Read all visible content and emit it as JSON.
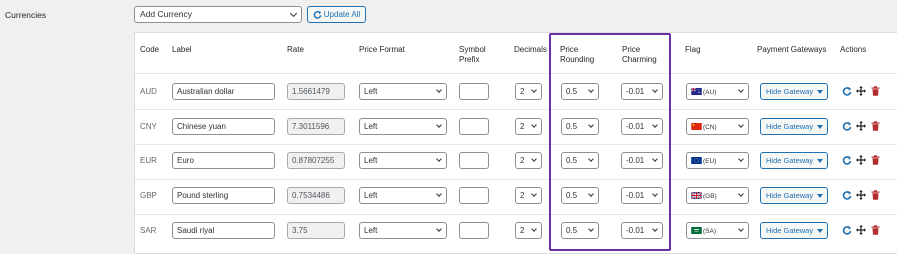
{
  "section_label": "Currencies",
  "toolbar": {
    "add_currency_value": "Add Currency",
    "update_label": "Update All"
  },
  "headers": {
    "code": "Code",
    "label": "Label",
    "rate": "Rate",
    "price_format": "Price Format",
    "symbol_prefix_1": "Symbol",
    "symbol_prefix_2": "Prefix",
    "decimals": "Decimals",
    "price_rounding_1": "Price",
    "price_rounding_2": "Rounding",
    "price_charming_1": "Price",
    "price_charming_2": "Charming",
    "flag": "Flag",
    "payment_gateways": "Payment Gateways",
    "actions": "Actions"
  },
  "rows": [
    {
      "code": "AUD",
      "label": "Australian dollar",
      "rate": "1.5661479",
      "format": "Left",
      "prefix": "",
      "decimals": "2",
      "rounding": "0.5",
      "charming": "-0.01",
      "flag": "(AU)",
      "gateway": "Hide Gateway"
    },
    {
      "code": "CNY",
      "label": "Chinese yuan",
      "rate": "7.3011596",
      "format": "Left",
      "prefix": "",
      "decimals": "2",
      "rounding": "0.5",
      "charming": "-0.01",
      "flag": "(CN)",
      "gateway": "Hide Gateway"
    },
    {
      "code": "EUR",
      "label": "Euro",
      "rate": "0.87807255",
      "format": "Left",
      "prefix": "",
      "decimals": "2",
      "rounding": "0.5",
      "charming": "-0.01",
      "flag": "(EU)",
      "gateway": "Hide Gateway"
    },
    {
      "code": "GBP",
      "label": "Pound sterling",
      "rate": "0.7534486",
      "format": "Left",
      "prefix": "",
      "decimals": "2",
      "rounding": "0.5",
      "charming": "-0.01",
      "flag": "(GB)",
      "gateway": "Hide Gateway"
    },
    {
      "code": "SAR",
      "label": "Saudi riyal",
      "rate": "3.75",
      "format": "Left",
      "prefix": "",
      "decimals": "2",
      "rounding": "0.5",
      "charming": "-0.01",
      "flag": "(SA)",
      "gateway": "Hide Gateway"
    }
  ],
  "colors": {
    "accent": "#2271b1",
    "highlight": "#6b2fa3",
    "delete": "#b32d2e"
  },
  "icons": {
    "update": "refresh-icon",
    "refresh": "refresh-icon",
    "move": "move-icon",
    "delete": "trash-icon"
  }
}
